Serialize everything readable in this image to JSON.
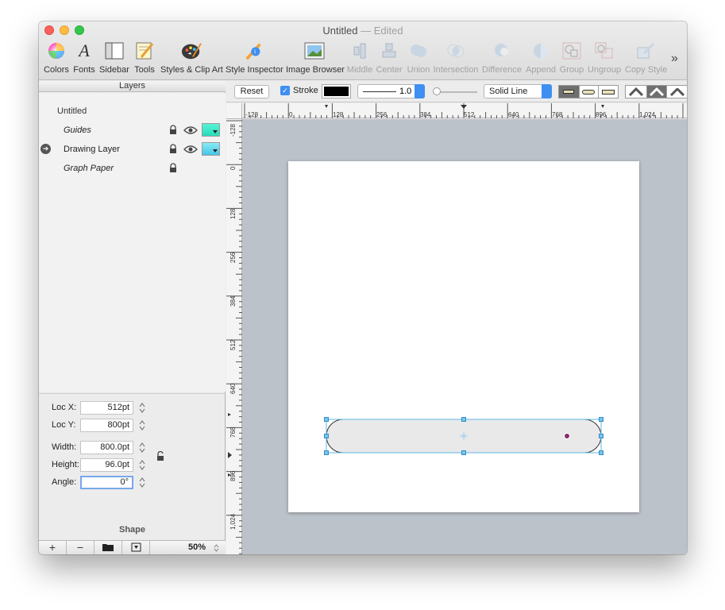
{
  "window": {
    "title": "Untitled",
    "status": "— Edited"
  },
  "toolbar": {
    "items": [
      {
        "label": "Colors",
        "icon": "color-wheel-icon",
        "enabled": true
      },
      {
        "label": "Fonts",
        "icon": "fonts-icon",
        "enabled": true
      },
      {
        "label": "Sidebar",
        "icon": "sidebar-icon",
        "enabled": true
      },
      {
        "label": "Tools",
        "icon": "tools-icon",
        "enabled": true
      },
      {
        "label": "Styles & Clip Art",
        "icon": "palette-icon",
        "enabled": true
      },
      {
        "label": "Style Inspector",
        "icon": "style-inspector-icon",
        "enabled": true
      },
      {
        "label": "Image Browser",
        "icon": "image-browser-icon",
        "enabled": true
      },
      {
        "label": "Middle",
        "icon": "middle-align-icon",
        "enabled": false
      },
      {
        "label": "Center",
        "icon": "center-align-icon",
        "enabled": false
      },
      {
        "label": "Union",
        "icon": "union-icon",
        "enabled": false
      },
      {
        "label": "Intersection",
        "icon": "intersection-icon",
        "enabled": false
      },
      {
        "label": "Difference",
        "icon": "difference-icon",
        "enabled": false
      },
      {
        "label": "Append",
        "icon": "append-icon",
        "enabled": false
      },
      {
        "label": "Group",
        "icon": "group-icon",
        "enabled": false
      },
      {
        "label": "Ungroup",
        "icon": "ungroup-icon",
        "enabled": false
      },
      {
        "label": "Copy Style",
        "icon": "copy-style-icon",
        "enabled": false
      }
    ],
    "overflow": "»"
  },
  "layers": {
    "header": "Layers",
    "document": "Untitled",
    "items": [
      {
        "name": "Guides",
        "italic": true,
        "locked": true,
        "visible": true,
        "color": "#2fe3c2"
      },
      {
        "name": "Drawing Layer",
        "italic": false,
        "locked": true,
        "visible": true,
        "color": "#2fe3c2",
        "active": true
      },
      {
        "name": "Graph Paper",
        "italic": true,
        "locked": true
      }
    ]
  },
  "inspector": {
    "loc_x_label": "Loc X:",
    "loc_x": "512pt",
    "loc_y_label": "Loc Y:",
    "loc_y": "800pt",
    "width_label": "Width:",
    "width": "800.0pt",
    "height_label": "Height:",
    "height": "96.0pt",
    "angle_label": "Angle:",
    "angle": "0°",
    "section_title": "Shape"
  },
  "footer": {
    "add": "+",
    "remove": "−",
    "zoom": "50%"
  },
  "strokebar": {
    "reset_label": "Reset",
    "stroke_label": "Stroke",
    "stroke_checked": true,
    "stroke_color": "#000000",
    "stroke_width": "1.0",
    "line_style": "Solid Line"
  },
  "rulers": {
    "top_labels": [
      "-128",
      "0",
      "128",
      "256",
      "384",
      "512",
      "640",
      "768",
      "896",
      "1,024"
    ],
    "left_labels": [
      "-128",
      "0",
      "128",
      "256",
      "384",
      "512",
      "640",
      "768",
      "896",
      "1,024"
    ]
  }
}
